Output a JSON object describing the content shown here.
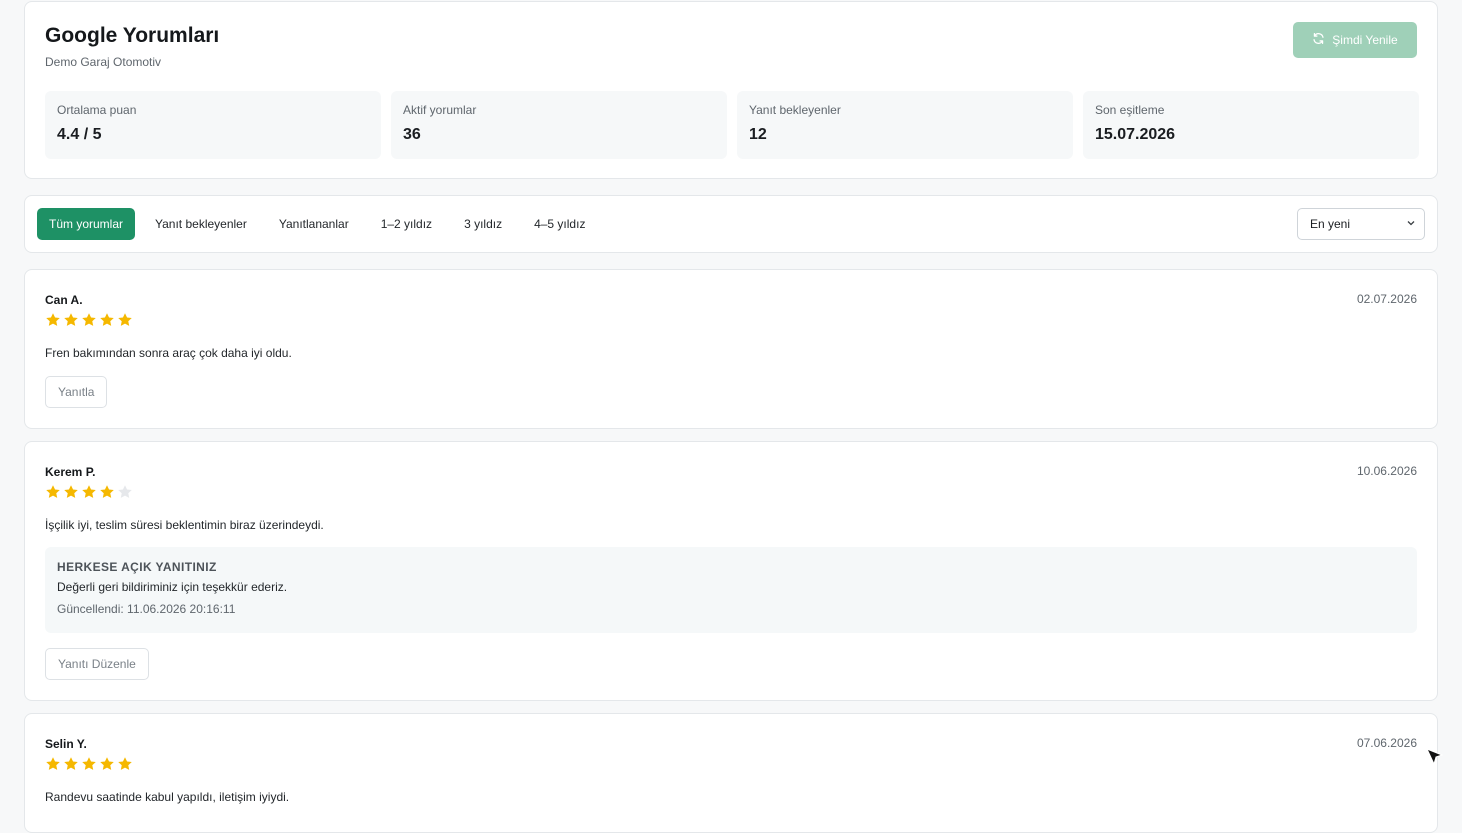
{
  "header": {
    "title": "Google Yorumları",
    "subtitle": "Demo Garaj Otomotiv",
    "refresh_label": "Şimdi Yenile",
    "refresh_icon": "refresh-icon"
  },
  "stats": [
    {
      "label": "Ortalama puan",
      "value": "4.4 / 5"
    },
    {
      "label": "Aktif yorumlar",
      "value": "36"
    },
    {
      "label": "Yanıt bekleyenler",
      "value": "12"
    },
    {
      "label": "Son eşitleme",
      "value": "15.07.2026"
    }
  ],
  "filters": {
    "tabs": [
      "Tüm yorumlar",
      "Yanıt bekleyenler",
      "Yanıtlananlar",
      "1–2 yıldız",
      "3 yıldız",
      "4–5 yıldız"
    ],
    "active_tab": 0,
    "sort_selected": "En yeni"
  },
  "reviews": [
    {
      "name": "Can A.",
      "date": "02.07.2026",
      "rating": 5,
      "text": "Fren bakımından sonra araç çok daha iyi oldu.",
      "action_label": "Yanıtla"
    },
    {
      "name": "Kerem P.",
      "date": "10.06.2026",
      "rating": 4,
      "text": "İşçilik iyi, teslim süresi beklentimin biraz üzerindeydi.",
      "reply": {
        "heading": "HERKESE AÇIK YANITINIZ",
        "text": "Değerli geri bildiriminiz için teşekkür ederiz.",
        "updated": "Güncellendi: 11.06.2026 20:16:11"
      },
      "action_label": "Yanıtı Düzenle"
    },
    {
      "name": "Selin Y.",
      "date": "07.06.2026",
      "rating": 5,
      "text": "Randevu saatinde kabul yapıldı, iletişim iyiydi."
    }
  ],
  "colors": {
    "accent": "#1e9165",
    "accent_disabled": "#9fd0b8",
    "star_filled": "#f5b800",
    "star_empty": "#e6e8eb"
  }
}
